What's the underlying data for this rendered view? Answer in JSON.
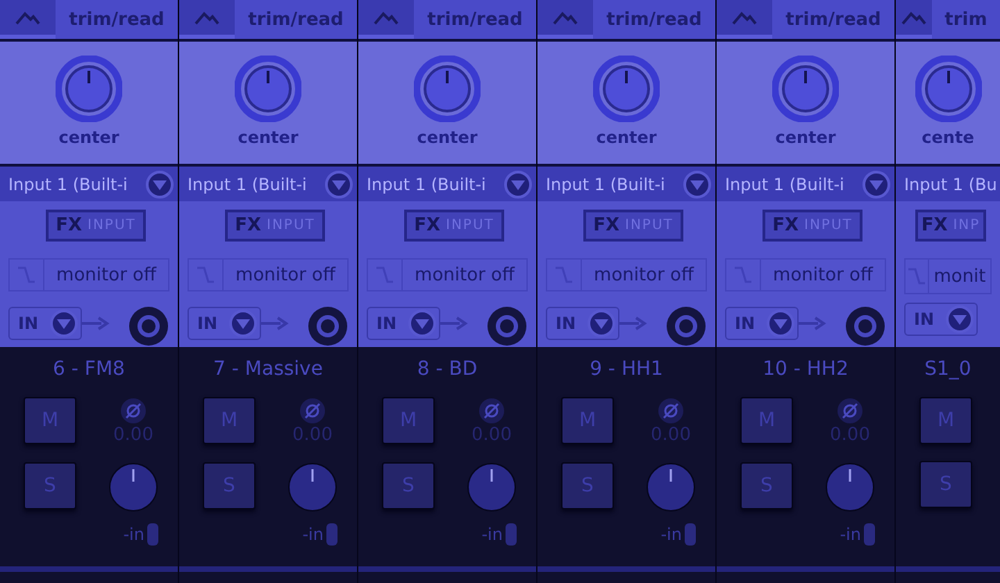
{
  "strips": [
    {
      "cut": false,
      "automation": "trim/read",
      "pan_label": "center",
      "input": "Input 1 (Built-i",
      "fx": "FX",
      "fx_input": "INPUT",
      "monitor": "monitor off",
      "in_label": "IN",
      "name": "6 - FM8",
      "mute": {
        "label": "M",
        "on": false
      },
      "solo": {
        "label": "S",
        "on": false
      },
      "volume": "0.00",
      "meter": "-in"
    },
    {
      "cut": false,
      "automation": "trim/read",
      "pan_label": "center",
      "input": "Input 1 (Built-i",
      "fx": "FX",
      "fx_input": "INPUT",
      "monitor": "monitor off",
      "in_label": "IN",
      "name": "7 - Massive",
      "mute": {
        "label": "M",
        "on": false
      },
      "solo": {
        "label": "S",
        "on": false
      },
      "volume": "0.00",
      "meter": "-in"
    },
    {
      "cut": false,
      "automation": "trim/read",
      "pan_label": "center",
      "input": "Input 1 (Built-i",
      "fx": "FX",
      "fx_input": "INPUT",
      "monitor": "monitor off",
      "in_label": "IN",
      "name": "8 - BD",
      "mute": {
        "label": "M",
        "on": false
      },
      "solo": {
        "label": "S",
        "on": false
      },
      "volume": "0.00",
      "meter": "-in"
    },
    {
      "cut": false,
      "automation": "trim/read",
      "pan_label": "center",
      "input": "Input 1 (Built-i",
      "fx": "FX",
      "fx_input": "INPUT",
      "monitor": "monitor off",
      "in_label": "IN",
      "name": "9 - HH1",
      "mute": {
        "label": "M",
        "on": false
      },
      "solo": {
        "label": "S",
        "on": false
      },
      "volume": "0.00",
      "meter": "-in"
    },
    {
      "cut": false,
      "automation": "trim/read",
      "pan_label": "center",
      "input": "Input 1 (Built-i",
      "fx": "FX",
      "fx_input": "INPUT",
      "monitor": "monitor off",
      "in_label": "IN",
      "name": "10 - HH2",
      "mute": {
        "label": "M",
        "on": false
      },
      "solo": {
        "label": "S",
        "on": false
      },
      "volume": "0.00",
      "meter": "-in"
    },
    {
      "cut": true,
      "automation": "trim",
      "pan_label": "cente",
      "input": "Input 1 (Bu",
      "fx": "FX",
      "fx_input": "INP",
      "monitor": "monit",
      "in_label": "IN",
      "name": "S1_0",
      "mute": {
        "label": "M",
        "on": false
      },
      "solo": {
        "label": "S",
        "on": false
      }
    }
  ]
}
